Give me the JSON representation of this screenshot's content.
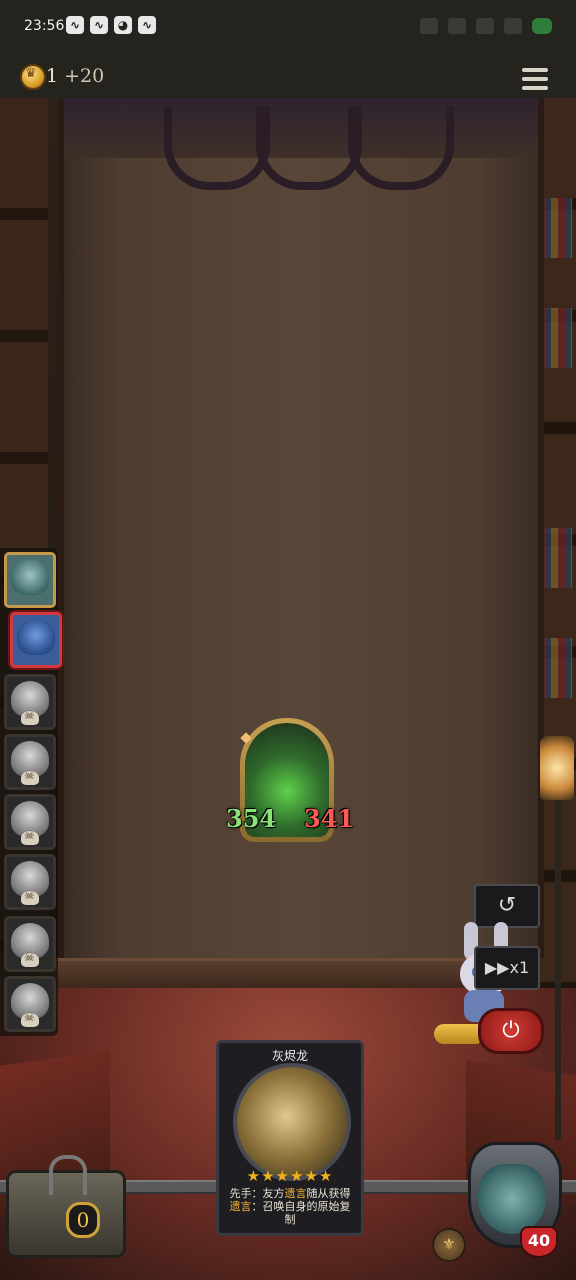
{
  "status_bar": {
    "time": "23:56",
    "notification_icons": [
      "notification-icon",
      "notification-icon",
      "wechat-icon",
      "notification-icon"
    ],
    "right_icons": [
      "bluetooth-icon",
      "signal-icon",
      "wifi-icon",
      "signal-icon",
      "battery-icon"
    ]
  },
  "top_bar": {
    "currency_icon": "crown-coin-icon",
    "currency_value": "1",
    "currency_delta": "+20",
    "menu_icon": "hamburger-menu-icon"
  },
  "roster": {
    "slots": [
      {
        "name": "shark-pirate",
        "state": "selected-gold"
      },
      {
        "name": "blue-merfolk",
        "state": "selected-red"
      },
      {
        "name": "opponent-3",
        "state": "eliminated"
      },
      {
        "name": "opponent-4",
        "state": "eliminated"
      },
      {
        "name": "opponent-5",
        "state": "eliminated"
      },
      {
        "name": "opponent-6",
        "state": "eliminated"
      },
      {
        "name": "opponent-7",
        "state": "eliminated"
      },
      {
        "name": "opponent-8",
        "state": "eliminated"
      }
    ]
  },
  "board_minion": {
    "attack": "354",
    "health": "341"
  },
  "controls": {
    "refresh_icon": "↺",
    "speed_label": "▶▶x1",
    "power_icon": "⏻"
  },
  "chest": {
    "count": "0"
  },
  "card": {
    "name": "灰烬龙",
    "stars": "★★★★★★",
    "desc_1": "先手：友方",
    "desc_kw1": "遗言",
    "desc_2": "随从获得",
    "desc_kw2": "遗言",
    "desc_3": "：召唤自身的原始复制"
  },
  "hero": {
    "health": "40",
    "ability_icon": "⚜"
  }
}
